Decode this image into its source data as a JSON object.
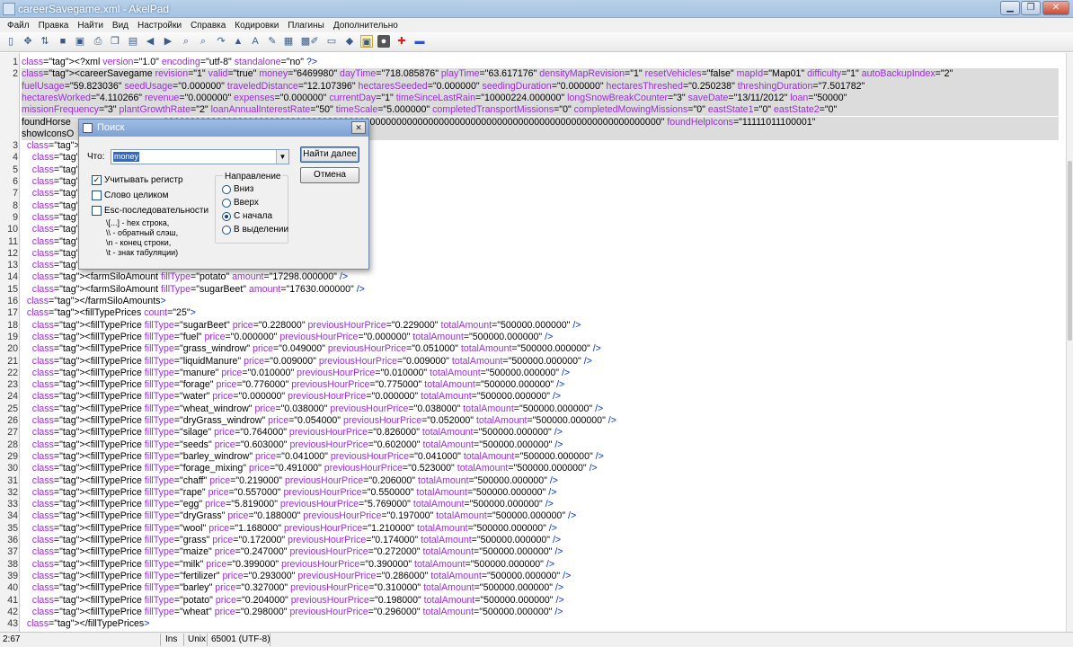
{
  "window": {
    "title": "careerSavegame.xml - AkelPad"
  },
  "menu": [
    "Файл",
    "Правка",
    "Найти",
    "Вид",
    "Настройки",
    "Справка",
    "Кодировки",
    "Плагины",
    "Дополнительно"
  ],
  "toolbar": {
    "icons": [
      "new-file-icon",
      "move-icon",
      "refresh-icon",
      "save-icon",
      "save-all-icon",
      "print-icon",
      "copy-icon",
      "paste-icon",
      "undo-icon",
      "redo-icon",
      "find-icon",
      "replace-icon",
      "goto-icon",
      "format-icon",
      "font-icon",
      "tools-icon",
      "color-icon",
      "calendar-icon",
      "edit-icon",
      "folder-icon",
      "purple-icon",
      "image-icon",
      "record-icon",
      "add-icon",
      "remove-icon"
    ]
  },
  "editor": {
    "line_numbers": [
      "1",
      "2",
      "",
      "",
      "",
      "",
      "",
      "3",
      "4",
      "5",
      "6",
      "7",
      "8",
      "9",
      "10",
      "11",
      "12",
      "13",
      "14",
      "15",
      "16",
      "17",
      "18",
      "19",
      "20",
      "21",
      "22",
      "23",
      "24",
      "25",
      "26",
      "27",
      "28",
      "29",
      "30",
      "31",
      "32",
      "33",
      "34",
      "35",
      "36",
      "37",
      "38",
      "39",
      "40",
      "41",
      "42",
      "43"
    ],
    "lines": [
      "<?xml version=\"1.0\" encoding=\"utf-8\" standalone=\"no\" ?>",
      "<careerSavegame revision=\"1\" valid=\"true\" money=\"6469980\" dayTime=\"718.085876\" playTime=\"63.617176\" densityMapRevision=\"1\" resetVehicles=\"false\" mapId=\"Map01\" difficulty=\"1\" autoBackupIndex=\"2\"",
      "fuelUsage=\"59.823036\" seedUsage=\"0.000000\" traveledDistance=\"12.107396\" hectaresSeeded=\"0.000000\" seedingDuration=\"0.000000\" hectaresThreshed=\"0.250238\" threshingDuration=\"7.501782\"",
      "hectaresWorked=\"4.110266\" revenue=\"0.000000\" expenses=\"0.000000\" currentDay=\"1\" timeSinceLastRain=\"10000224.000000\" longSnowBreakCounter=\"3\" saveDate=\"13/11/2012\" loan=\"50000\"",
      "missionFrequency=\"3\" plantGrowthRate=\"2\" loanAnnualInterestRate=\"50\" timeScale=\"5.000000\" completedTransportMissions=\"0\" completedMowingMissions=\"0\" eastState1=\"0\" eastState2=\"0\"",
      "foundHorse                                   0000000000000000000000000000000000000000000000000000000000000000000000000000000000000000000000\" foundHelpIcons=\"11111011100001\"",
      "showIconsO",
      "  <farmSiloAmounts>",
      "    <farmSi",
      "    <farmSi",
      "    <farmSi",
      "    <farmSi",
      "    <farmSi",
      "    <farmSi",
      "    <farmSi",
      "    <farmSi",
      "    <farmSi",
      "    <farmSi",
      "    <farmSiloAmount fillType=\"potato\" amount=\"17298.000000\" />",
      "    <farmSiloAmount fillType=\"sugarBeet\" amount=\"17630.000000\" />",
      "  </farmSiloAmounts>",
      "  <fillTypePrices count=\"25\">",
      "    <fillTypePrice fillType=\"sugarBeet\" price=\"0.228000\" previousHourPrice=\"0.229000\" totalAmount=\"500000.000000\" />",
      "    <fillTypePrice fillType=\"fuel\" price=\"0.000000\" previousHourPrice=\"0.000000\" totalAmount=\"500000.000000\" />",
      "    <fillTypePrice fillType=\"grass_windrow\" price=\"0.049000\" previousHourPrice=\"0.051000\" totalAmount=\"500000.000000\" />",
      "    <fillTypePrice fillType=\"liquidManure\" price=\"0.009000\" previousHourPrice=\"0.009000\" totalAmount=\"500000.000000\" />",
      "    <fillTypePrice fillType=\"manure\" price=\"0.010000\" previousHourPrice=\"0.010000\" totalAmount=\"500000.000000\" />",
      "    <fillTypePrice fillType=\"forage\" price=\"0.776000\" previousHourPrice=\"0.775000\" totalAmount=\"500000.000000\" />",
      "    <fillTypePrice fillType=\"water\" price=\"0.000000\" previousHourPrice=\"0.000000\" totalAmount=\"500000.000000\" />",
      "    <fillTypePrice fillType=\"wheat_windrow\" price=\"0.038000\" previousHourPrice=\"0.038000\" totalAmount=\"500000.000000\" />",
      "    <fillTypePrice fillType=\"dryGrass_windrow\" price=\"0.054000\" previousHourPrice=\"0.052000\" totalAmount=\"500000.000000\" />",
      "    <fillTypePrice fillType=\"silage\" price=\"0.764000\" previousHourPrice=\"0.826000\" totalAmount=\"500000.000000\" />",
      "    <fillTypePrice fillType=\"seeds\" price=\"0.603000\" previousHourPrice=\"0.602000\" totalAmount=\"500000.000000\" />",
      "    <fillTypePrice fillType=\"barley_windrow\" price=\"0.041000\" previousHourPrice=\"0.041000\" totalAmount=\"500000.000000\" />",
      "    <fillTypePrice fillType=\"forage_mixing\" price=\"0.491000\" previousHourPrice=\"0.523000\" totalAmount=\"500000.000000\" />",
      "    <fillTypePrice fillType=\"chaff\" price=\"0.219000\" previousHourPrice=\"0.206000\" totalAmount=\"500000.000000\" />",
      "    <fillTypePrice fillType=\"rape\" price=\"0.557000\" previousHourPrice=\"0.550000\" totalAmount=\"500000.000000\" />",
      "    <fillTypePrice fillType=\"egg\" price=\"5.819000\" previousHourPrice=\"5.769000\" totalAmount=\"500000.000000\" />",
      "    <fillTypePrice fillType=\"dryGrass\" price=\"0.188000\" previousHourPrice=\"0.197000\" totalAmount=\"500000.000000\" />",
      "    <fillTypePrice fillType=\"wool\" price=\"1.168000\" previousHourPrice=\"1.210000\" totalAmount=\"500000.000000\" />",
      "    <fillTypePrice fillType=\"grass\" price=\"0.172000\" previousHourPrice=\"0.174000\" totalAmount=\"500000.000000\" />",
      "    <fillTypePrice fillType=\"maize\" price=\"0.247000\" previousHourPrice=\"0.272000\" totalAmount=\"500000.000000\" />",
      "    <fillTypePrice fillType=\"milk\" price=\"0.399000\" previousHourPrice=\"0.390000\" totalAmount=\"500000.000000\" />",
      "    <fillTypePrice fillType=\"fertilizer\" price=\"0.293000\" previousHourPrice=\"0.286000\" totalAmount=\"500000.000000\" />",
      "    <fillTypePrice fillType=\"barley\" price=\"0.327000\" previousHourPrice=\"0.310000\" totalAmount=\"500000.000000\" />",
      "    <fillTypePrice fillType=\"potato\" price=\"0.204000\" previousHourPrice=\"0.198000\" totalAmount=\"500000.000000\" />",
      "    <fillTypePrice fillType=\"wheat\" price=\"0.298000\" previousHourPrice=\"0.296000\" totalAmount=\"500000.000000\" />",
      "  </fillTypePrices>"
    ]
  },
  "find_dialog": {
    "title": "Поиск",
    "what_label": "Что:",
    "what_value": "money",
    "find_next": "Найти далее",
    "cancel": "Отмена",
    "match_case": "Учитывать регистр",
    "match_case_checked": true,
    "whole_word": "Слово целиком",
    "whole_word_checked": false,
    "escape_seq": "Esc-последовательности",
    "escape_seq_checked": false,
    "escape_help": [
      "\\[...] - hex строка,",
      "\\\\ - обратный слэш,",
      "\\n - конец строки,",
      "\\t - знак табуляции)"
    ],
    "direction_label": "Направление",
    "directions": [
      "Вниз",
      "Вверх",
      "С начала",
      "В выделении"
    ],
    "selected_direction": "С начала"
  },
  "status": {
    "position": "2:67",
    "mode": "Ins",
    "line_ending": "Unix",
    "encoding": "65001 (UTF-8)"
  }
}
